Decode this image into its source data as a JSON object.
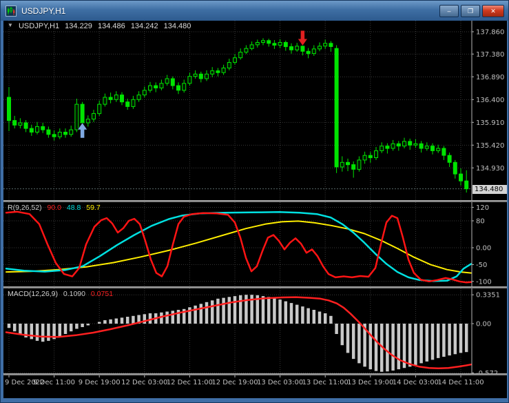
{
  "window": {
    "title": "USDJPY,H1",
    "controls": {
      "minimize": "–",
      "restore": "❐",
      "close": "✕"
    }
  },
  "chart": {
    "ohlc": {
      "arrow": "▼",
      "symbol": "USDJPY,H1",
      "open": "134.229",
      "high": "134.486",
      "low": "134.242",
      "close": "134.480"
    },
    "price_axis": {
      "current": "134.480"
    }
  },
  "indicators": {
    "wpr": {
      "label": "R(9,26,52)",
      "value_fast": "90.0",
      "value_mid": "48.8",
      "value_slow": "59.7"
    },
    "macd": {
      "label": "MACD(12,26,9)",
      "value_main": "0.1090",
      "value_signal": "0.0751"
    }
  },
  "colors": {
    "background": "#000000",
    "grid": "#3a3a3a",
    "axis_text": "#c0c0c0",
    "axis_border": "#b8b8b8",
    "candle": "#00e400",
    "candle_bull_fill": "#001c00",
    "wpr_fast": "#ff1414",
    "wpr_mid": "#00e0e0",
    "wpr_slow": "#ffee00",
    "macd_hist": "#c8c8c8",
    "macd_signal": "#ff2020",
    "bid_line": "#5a6a6a",
    "current_price_bg": "#d4d4d4"
  },
  "chart_data": {
    "type": "candlestick",
    "symbol": "USDJPY",
    "timeframe": "H1",
    "time_ticks": [
      "9 Dec 2022",
      "9 Dec 11:00",
      "9 Dec 19:00",
      "12 Dec 03:00",
      "12 Dec 11:00",
      "12 Dec 19:00",
      "13 Dec 03:00",
      "13 Dec 11:00",
      "13 Dec 19:00",
      "14 Dec 03:00",
      "14 Dec 11:00"
    ],
    "price_ticks": [
      "137.860",
      "137.380",
      "136.890",
      "136.400",
      "135.910",
      "135.420",
      "134.930"
    ],
    "current_price": "134.480",
    "candles": [
      [
        136.45,
        136.67,
        135.72,
        135.95
      ],
      [
        135.95,
        136.05,
        135.78,
        135.85
      ],
      [
        135.85,
        136.0,
        135.78,
        135.9
      ],
      [
        135.9,
        135.96,
        135.7,
        135.78
      ],
      [
        135.78,
        135.86,
        135.62,
        135.7
      ],
      [
        135.7,
        135.92,
        135.65,
        135.82
      ],
      [
        135.82,
        135.9,
        135.68,
        135.75
      ],
      [
        135.75,
        135.82,
        135.58,
        135.65
      ],
      [
        135.65,
        135.74,
        135.52,
        135.6
      ],
      [
        135.6,
        135.78,
        135.55,
        135.7
      ],
      [
        135.7,
        135.78,
        135.58,
        135.65
      ],
      [
        135.65,
        135.84,
        135.6,
        135.75
      ],
      [
        135.75,
        136.42,
        135.7,
        136.3
      ],
      [
        136.3,
        136.35,
        135.62,
        135.9
      ],
      [
        135.9,
        136.06,
        135.82,
        135.98
      ],
      [
        135.98,
        136.18,
        135.92,
        136.1
      ],
      [
        136.1,
        136.38,
        136.05,
        136.3
      ],
      [
        136.3,
        136.53,
        136.25,
        136.45
      ],
      [
        136.45,
        136.55,
        136.32,
        136.4
      ],
      [
        136.4,
        136.58,
        136.35,
        136.5
      ],
      [
        136.5,
        136.56,
        136.28,
        136.35
      ],
      [
        136.35,
        136.42,
        136.18,
        136.25
      ],
      [
        136.25,
        136.48,
        136.2,
        136.4
      ],
      [
        136.4,
        136.58,
        136.35,
        136.5
      ],
      [
        136.5,
        136.68,
        136.45,
        136.6
      ],
      [
        136.6,
        136.78,
        136.55,
        136.7
      ],
      [
        136.7,
        136.77,
        136.56,
        136.65
      ],
      [
        136.65,
        136.83,
        136.6,
        136.75
      ],
      [
        136.75,
        136.93,
        136.7,
        136.85
      ],
      [
        136.85,
        136.9,
        136.62,
        136.7
      ],
      [
        136.7,
        136.77,
        136.52,
        136.6
      ],
      [
        136.6,
        136.83,
        136.55,
        136.75
      ],
      [
        136.75,
        136.98,
        136.7,
        136.9
      ],
      [
        136.9,
        137.03,
        136.85,
        136.95
      ],
      [
        136.95,
        137.0,
        136.77,
        136.85
      ],
      [
        136.85,
        137.03,
        136.8,
        136.95
      ],
      [
        136.95,
        137.1,
        136.88,
        137.02
      ],
      [
        137.02,
        137.08,
        136.9,
        136.98
      ],
      [
        136.98,
        137.15,
        136.93,
        137.08
      ],
      [
        137.08,
        137.28,
        137.03,
        137.2
      ],
      [
        137.2,
        137.38,
        137.15,
        137.3
      ],
      [
        137.3,
        137.5,
        137.26,
        137.42
      ],
      [
        137.42,
        137.57,
        137.38,
        137.5
      ],
      [
        137.5,
        137.65,
        137.46,
        137.58
      ],
      [
        137.58,
        137.69,
        137.52,
        137.63
      ],
      [
        137.63,
        137.72,
        137.57,
        137.67
      ],
      [
        137.67,
        137.71,
        137.54,
        137.61
      ],
      [
        137.61,
        137.68,
        137.49,
        137.57
      ],
      [
        137.57,
        137.7,
        137.51,
        137.63
      ],
      [
        137.63,
        137.67,
        137.45,
        137.54
      ],
      [
        137.54,
        137.61,
        137.39,
        137.47
      ],
      [
        137.47,
        137.62,
        137.43,
        137.55
      ],
      [
        137.55,
        137.6,
        137.35,
        137.44
      ],
      [
        137.44,
        137.51,
        137.29,
        137.39
      ],
      [
        137.39,
        137.57,
        137.34,
        137.49
      ],
      [
        137.49,
        137.63,
        137.44,
        137.55
      ],
      [
        137.55,
        137.69,
        137.49,
        137.61
      ],
      [
        137.61,
        137.66,
        137.43,
        137.54
      ],
      [
        137.5,
        137.57,
        134.82,
        134.95
      ],
      [
        134.95,
        135.18,
        134.85,
        135.05
      ],
      [
        135.05,
        135.13,
        134.86,
        135.0
      ],
      [
        135.0,
        135.07,
        134.72,
        134.9
      ],
      [
        134.9,
        135.18,
        134.85,
        135.1
      ],
      [
        135.1,
        135.28,
        135.02,
        135.2
      ],
      [
        135.2,
        135.27,
        135.04,
        135.15
      ],
      [
        135.15,
        135.38,
        135.1,
        135.3
      ],
      [
        135.3,
        135.48,
        135.25,
        135.4
      ],
      [
        135.4,
        135.46,
        135.24,
        135.35
      ],
      [
        135.35,
        135.53,
        135.3,
        135.45
      ],
      [
        135.45,
        135.51,
        135.3,
        135.4
      ],
      [
        135.4,
        135.58,
        135.35,
        135.5
      ],
      [
        135.5,
        135.56,
        135.32,
        135.42
      ],
      [
        135.42,
        135.55,
        135.36,
        135.45
      ],
      [
        135.45,
        135.51,
        135.26,
        135.35
      ],
      [
        135.35,
        135.48,
        135.3,
        135.4
      ],
      [
        135.4,
        135.46,
        135.22,
        135.3
      ],
      [
        135.3,
        135.43,
        135.25,
        135.35
      ],
      [
        135.35,
        135.4,
        135.1,
        135.2
      ],
      [
        135.2,
        135.26,
        134.95,
        135.05
      ],
      [
        135.05,
        135.1,
        134.7,
        134.8
      ],
      [
        134.8,
        134.92,
        134.55,
        134.65
      ],
      [
        134.65,
        134.88,
        134.4,
        134.48
      ]
    ],
    "markers": [
      {
        "shape": "arrow-down",
        "bar": 52,
        "price": 137.56,
        "color": "#e02020"
      },
      {
        "shape": "arrow-up",
        "bar": 13,
        "price": 135.9,
        "color": "#7fa8e0"
      }
    ],
    "wpr": {
      "axis": [
        {
          "label": "120",
          "value": 120
        },
        {
          "label": "80",
          "value": 80
        },
        {
          "label": "0.00",
          "value": 0
        },
        {
          "label": "-50",
          "value": -50
        },
        {
          "label": "-100",
          "value": -100
        }
      ],
      "fast": [
        [
          4,
          104
        ],
        [
          20,
          107
        ],
        [
          38,
          100
        ],
        [
          52,
          70
        ],
        [
          64,
          10
        ],
        [
          76,
          -45
        ],
        [
          88,
          -78
        ],
        [
          100,
          -85
        ],
        [
          110,
          -60
        ],
        [
          120,
          10
        ],
        [
          132,
          62
        ],
        [
          142,
          82
        ],
        [
          150,
          88
        ],
        [
          158,
          72
        ],
        [
          166,
          45
        ],
        [
          174,
          58
        ],
        [
          182,
          80
        ],
        [
          190,
          86
        ],
        [
          198,
          70
        ],
        [
          206,
          20
        ],
        [
          214,
          -35
        ],
        [
          222,
          -75
        ],
        [
          230,
          -85
        ],
        [
          238,
          -55
        ],
        [
          246,
          10
        ],
        [
          254,
          70
        ],
        [
          262,
          92
        ],
        [
          274,
          100
        ],
        [
          290,
          103
        ],
        [
          310,
          102
        ],
        [
          326,
          98
        ],
        [
          336,
          75
        ],
        [
          344,
          30
        ],
        [
          352,
          -30
        ],
        [
          360,
          -70
        ],
        [
          368,
          -55
        ],
        [
          376,
          -10
        ],
        [
          384,
          30
        ],
        [
          392,
          38
        ],
        [
          400,
          20
        ],
        [
          408,
          -5
        ],
        [
          416,
          15
        ],
        [
          424,
          28
        ],
        [
          432,
          12
        ],
        [
          440,
          -15
        ],
        [
          448,
          -5
        ],
        [
          456,
          -25
        ],
        [
          464,
          -55
        ],
        [
          472,
          -78
        ],
        [
          482,
          -88
        ],
        [
          494,
          -85
        ],
        [
          506,
          -88
        ],
        [
          518,
          -84
        ],
        [
          530,
          -86
        ],
        [
          540,
          -60
        ],
        [
          548,
          10
        ],
        [
          556,
          75
        ],
        [
          564,
          95
        ],
        [
          572,
          88
        ],
        [
          580,
          30
        ],
        [
          588,
          -35
        ],
        [
          596,
          -75
        ],
        [
          606,
          -95
        ],
        [
          618,
          -100
        ],
        [
          630,
          -96
        ],
        [
          642,
          -90
        ],
        [
          652,
          -94
        ],
        [
          662,
          -100
        ],
        [
          672,
          -103
        ],
        [
          679,
          -102
        ]
      ],
      "mid": [
        [
          4,
          -62
        ],
        [
          30,
          -68
        ],
        [
          60,
          -71
        ],
        [
          90,
          -66
        ],
        [
          115,
          -55
        ],
        [
          140,
          -25
        ],
        [
          165,
          8
        ],
        [
          190,
          38
        ],
        [
          215,
          65
        ],
        [
          240,
          85
        ],
        [
          260,
          96
        ],
        [
          285,
          102
        ],
        [
          320,
          104
        ],
        [
          360,
          105
        ],
        [
          400,
          106
        ],
        [
          430,
          104
        ],
        [
          455,
          100
        ],
        [
          475,
          90
        ],
        [
          492,
          70
        ],
        [
          508,
          45
        ],
        [
          524,
          15
        ],
        [
          540,
          -18
        ],
        [
          556,
          -48
        ],
        [
          572,
          -72
        ],
        [
          588,
          -88
        ],
        [
          604,
          -96
        ],
        [
          624,
          -99
        ],
        [
          644,
          -98
        ],
        [
          658,
          -85
        ],
        [
          668,
          -62
        ],
        [
          679,
          -48
        ]
      ],
      "slow": [
        [
          4,
          -72
        ],
        [
          40,
          -70
        ],
        [
          80,
          -65
        ],
        [
          120,
          -57
        ],
        [
          160,
          -44
        ],
        [
          200,
          -27
        ],
        [
          240,
          -8
        ],
        [
          280,
          14
        ],
        [
          320,
          38
        ],
        [
          352,
          57
        ],
        [
          380,
          70
        ],
        [
          404,
          77
        ],
        [
          428,
          79
        ],
        [
          452,
          74
        ],
        [
          476,
          66
        ],
        [
          500,
          56
        ],
        [
          524,
          42
        ],
        [
          548,
          22
        ],
        [
          572,
          -2
        ],
        [
          596,
          -28
        ],
        [
          620,
          -50
        ],
        [
          644,
          -65
        ],
        [
          664,
          -72
        ],
        [
          679,
          -75
        ]
      ]
    },
    "macd": {
      "axis": [
        {
          "label": "0.3351",
          "value": 0.3351
        },
        {
          "label": "0.00",
          "value": 0
        },
        {
          "label": "-0.572",
          "value": -0.572
        }
      ],
      "histogram": [
        -0.05,
        -0.09,
        -0.13,
        -0.16,
        -0.18,
        -0.2,
        -0.21,
        -0.2,
        -0.18,
        -0.15,
        -0.12,
        -0.09,
        -0.06,
        -0.04,
        -0.02,
        0.0,
        0.02,
        0.04,
        0.05,
        0.06,
        0.07,
        0.08,
        0.09,
        0.1,
        0.11,
        0.12,
        0.12,
        0.13,
        0.14,
        0.15,
        0.16,
        0.17,
        0.19,
        0.21,
        0.23,
        0.25,
        0.27,
        0.29,
        0.3,
        0.31,
        0.32,
        0.33,
        0.335,
        0.335,
        0.33,
        0.32,
        0.31,
        0.295,
        0.28,
        0.26,
        0.24,
        0.22,
        0.2,
        0.18,
        0.16,
        0.14,
        0.12,
        0.09,
        -0.12,
        -0.25,
        -0.34,
        -0.41,
        -0.46,
        -0.5,
        -0.53,
        -0.55,
        -0.56,
        -0.555,
        -0.545,
        -0.53,
        -0.515,
        -0.5,
        -0.48,
        -0.46,
        -0.44,
        -0.42,
        -0.4,
        -0.385,
        -0.37,
        -0.355,
        -0.34,
        -0.33
      ],
      "signal": [
        [
          4,
          -0.1
        ],
        [
          30,
          -0.13
        ],
        [
          55,
          -0.15
        ],
        [
          80,
          -0.155
        ],
        [
          105,
          -0.135
        ],
        [
          130,
          -0.105
        ],
        [
          155,
          -0.065
        ],
        [
          180,
          -0.02
        ],
        [
          205,
          0.03
        ],
        [
          230,
          0.08
        ],
        [
          255,
          0.125
        ],
        [
          280,
          0.165
        ],
        [
          305,
          0.205
        ],
        [
          330,
          0.245
        ],
        [
          355,
          0.275
        ],
        [
          380,
          0.295
        ],
        [
          405,
          0.305
        ],
        [
          425,
          0.308
        ],
        [
          445,
          0.3
        ],
        [
          460,
          0.29
        ],
        [
          472,
          0.27
        ],
        [
          484,
          0.235
        ],
        [
          494,
          0.185
        ],
        [
          504,
          0.115
        ],
        [
          514,
          0.035
        ],
        [
          524,
          -0.05
        ],
        [
          534,
          -0.14
        ],
        [
          544,
          -0.225
        ],
        [
          554,
          -0.3
        ],
        [
          564,
          -0.365
        ],
        [
          576,
          -0.425
        ],
        [
          590,
          -0.47
        ],
        [
          604,
          -0.5
        ],
        [
          618,
          -0.515
        ],
        [
          632,
          -0.52
        ],
        [
          646,
          -0.515
        ],
        [
          660,
          -0.5
        ],
        [
          672,
          -0.485
        ],
        [
          679,
          -0.475
        ]
      ]
    }
  }
}
